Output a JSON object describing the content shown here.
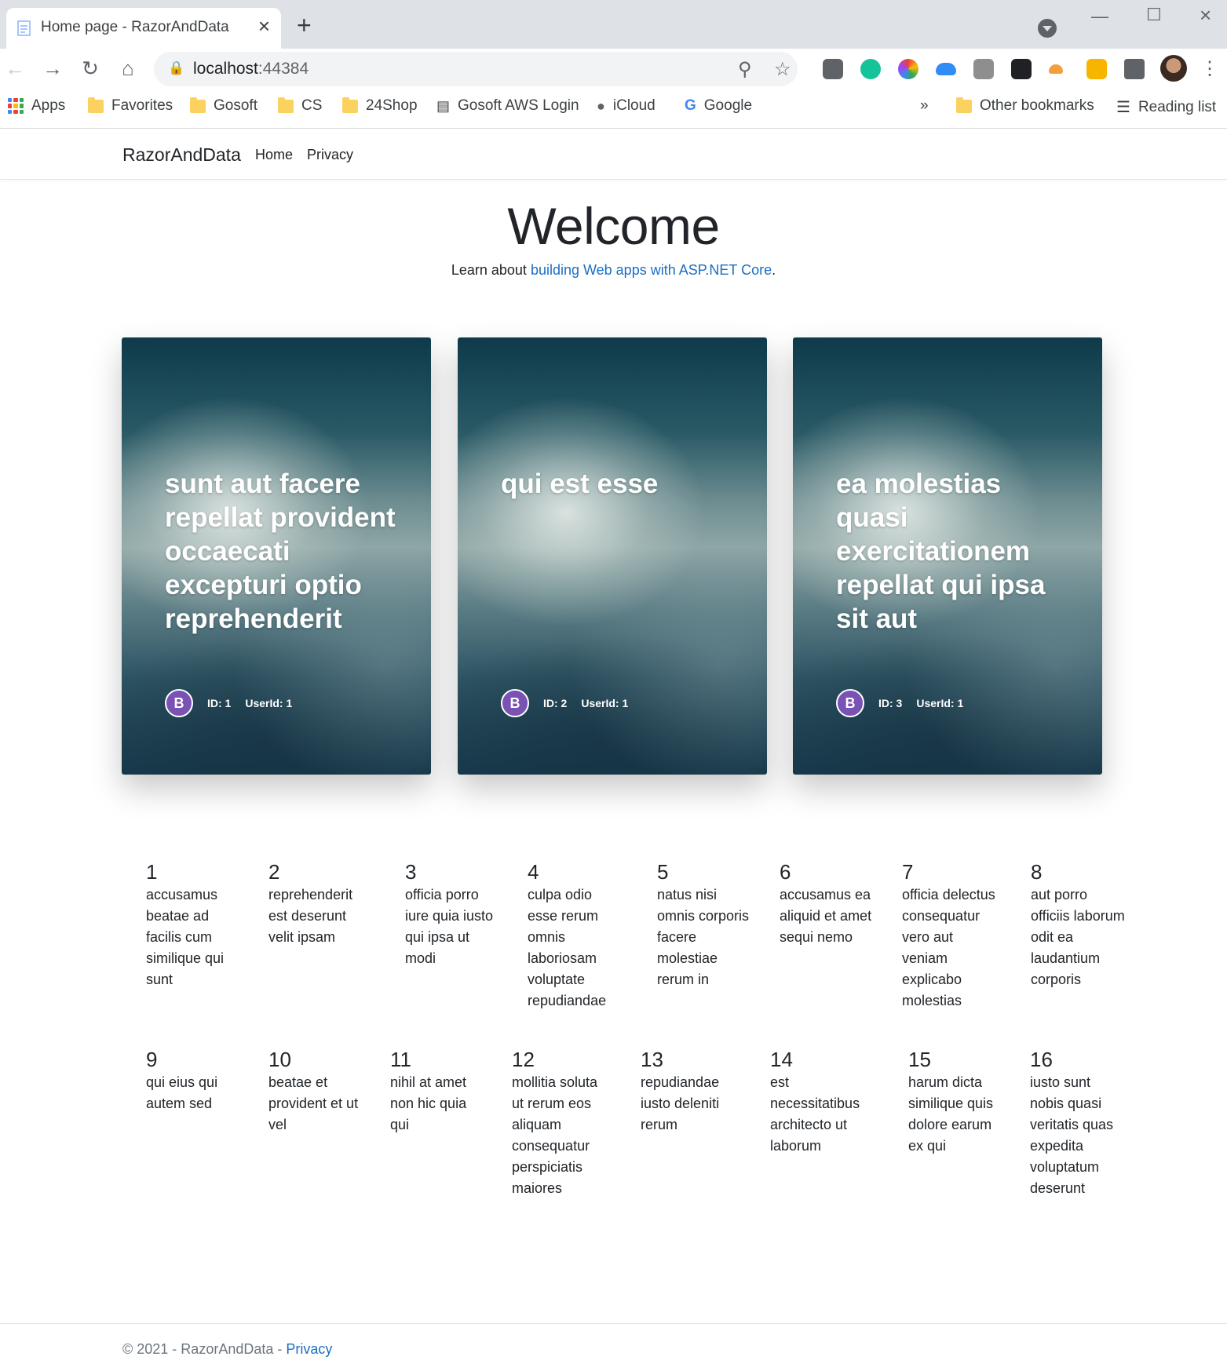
{
  "browser": {
    "tab_title": "Home page - RazorAndData",
    "url_host": "localhost",
    "url_port": ":44384",
    "bookmarks": [
      "Apps",
      "Favorites",
      "Gosoft",
      "CS",
      "24Shop",
      "Gosoft AWS Login",
      "iCloud",
      "Google"
    ],
    "overflow": "»",
    "other_bookmarks": "Other bookmarks",
    "reading_list": "Reading list"
  },
  "navbar": {
    "brand": "RazorAndData",
    "links": [
      "Home",
      "Privacy"
    ]
  },
  "hero": {
    "title": "Welcome",
    "learn_prefix": "Learn about ",
    "learn_link": "building Web apps with ASP.NET Core",
    "learn_suffix": "."
  },
  "cards": [
    {
      "title": "sunt aut facere repellat provident occaecati excepturi optio reprehenderit",
      "id": "ID: 1",
      "user": "UserId: 1",
      "logo": "B"
    },
    {
      "title": "qui est esse",
      "id": "ID: 2",
      "user": "UserId: 1",
      "logo": "B"
    },
    {
      "title": "ea molestias quasi exercitationem repellat qui ipsa sit aut",
      "id": "ID: 3",
      "user": "UserId: 1",
      "logo": "B"
    }
  ],
  "items": [
    {
      "num": "1",
      "text": "accusamus beatae ad facilis cum similique qui sunt"
    },
    {
      "num": "2",
      "text": "reprehenderit est deserunt velit ipsam"
    },
    {
      "num": "3",
      "text": "officia porro iure quia iusto qui ipsa ut modi"
    },
    {
      "num": "4",
      "text": "culpa odio esse rerum omnis laboriosam voluptate repudiandae"
    },
    {
      "num": "5",
      "text": "natus nisi omnis corporis facere molestiae rerum in"
    },
    {
      "num": "6",
      "text": "accusamus ea aliquid et amet sequi nemo"
    },
    {
      "num": "7",
      "text": "officia delectus consequatur vero aut veniam explicabo molestias"
    },
    {
      "num": "8",
      "text": "aut porro officiis laborum odit ea laudantium corporis"
    },
    {
      "num": "9",
      "text": "qui eius qui autem sed"
    },
    {
      "num": "10",
      "text": "beatae et provident et ut vel"
    },
    {
      "num": "11",
      "text": "nihil at amet non hic quia qui"
    },
    {
      "num": "12",
      "text": "mollitia soluta ut rerum eos aliquam consequatur perspiciatis maiores"
    },
    {
      "num": "13",
      "text": "repudiandae iusto deleniti rerum"
    },
    {
      "num": "14",
      "text": "est necessitatibus architecto ut laborum"
    },
    {
      "num": "15",
      "text": "harum dicta similique quis dolore earum ex qui"
    },
    {
      "num": "16",
      "text": "iusto sunt nobis quasi veritatis quas expedita voluptatum deserunt"
    }
  ],
  "footer": {
    "text": "© 2021 - RazorAndData - ",
    "link": "Privacy"
  }
}
